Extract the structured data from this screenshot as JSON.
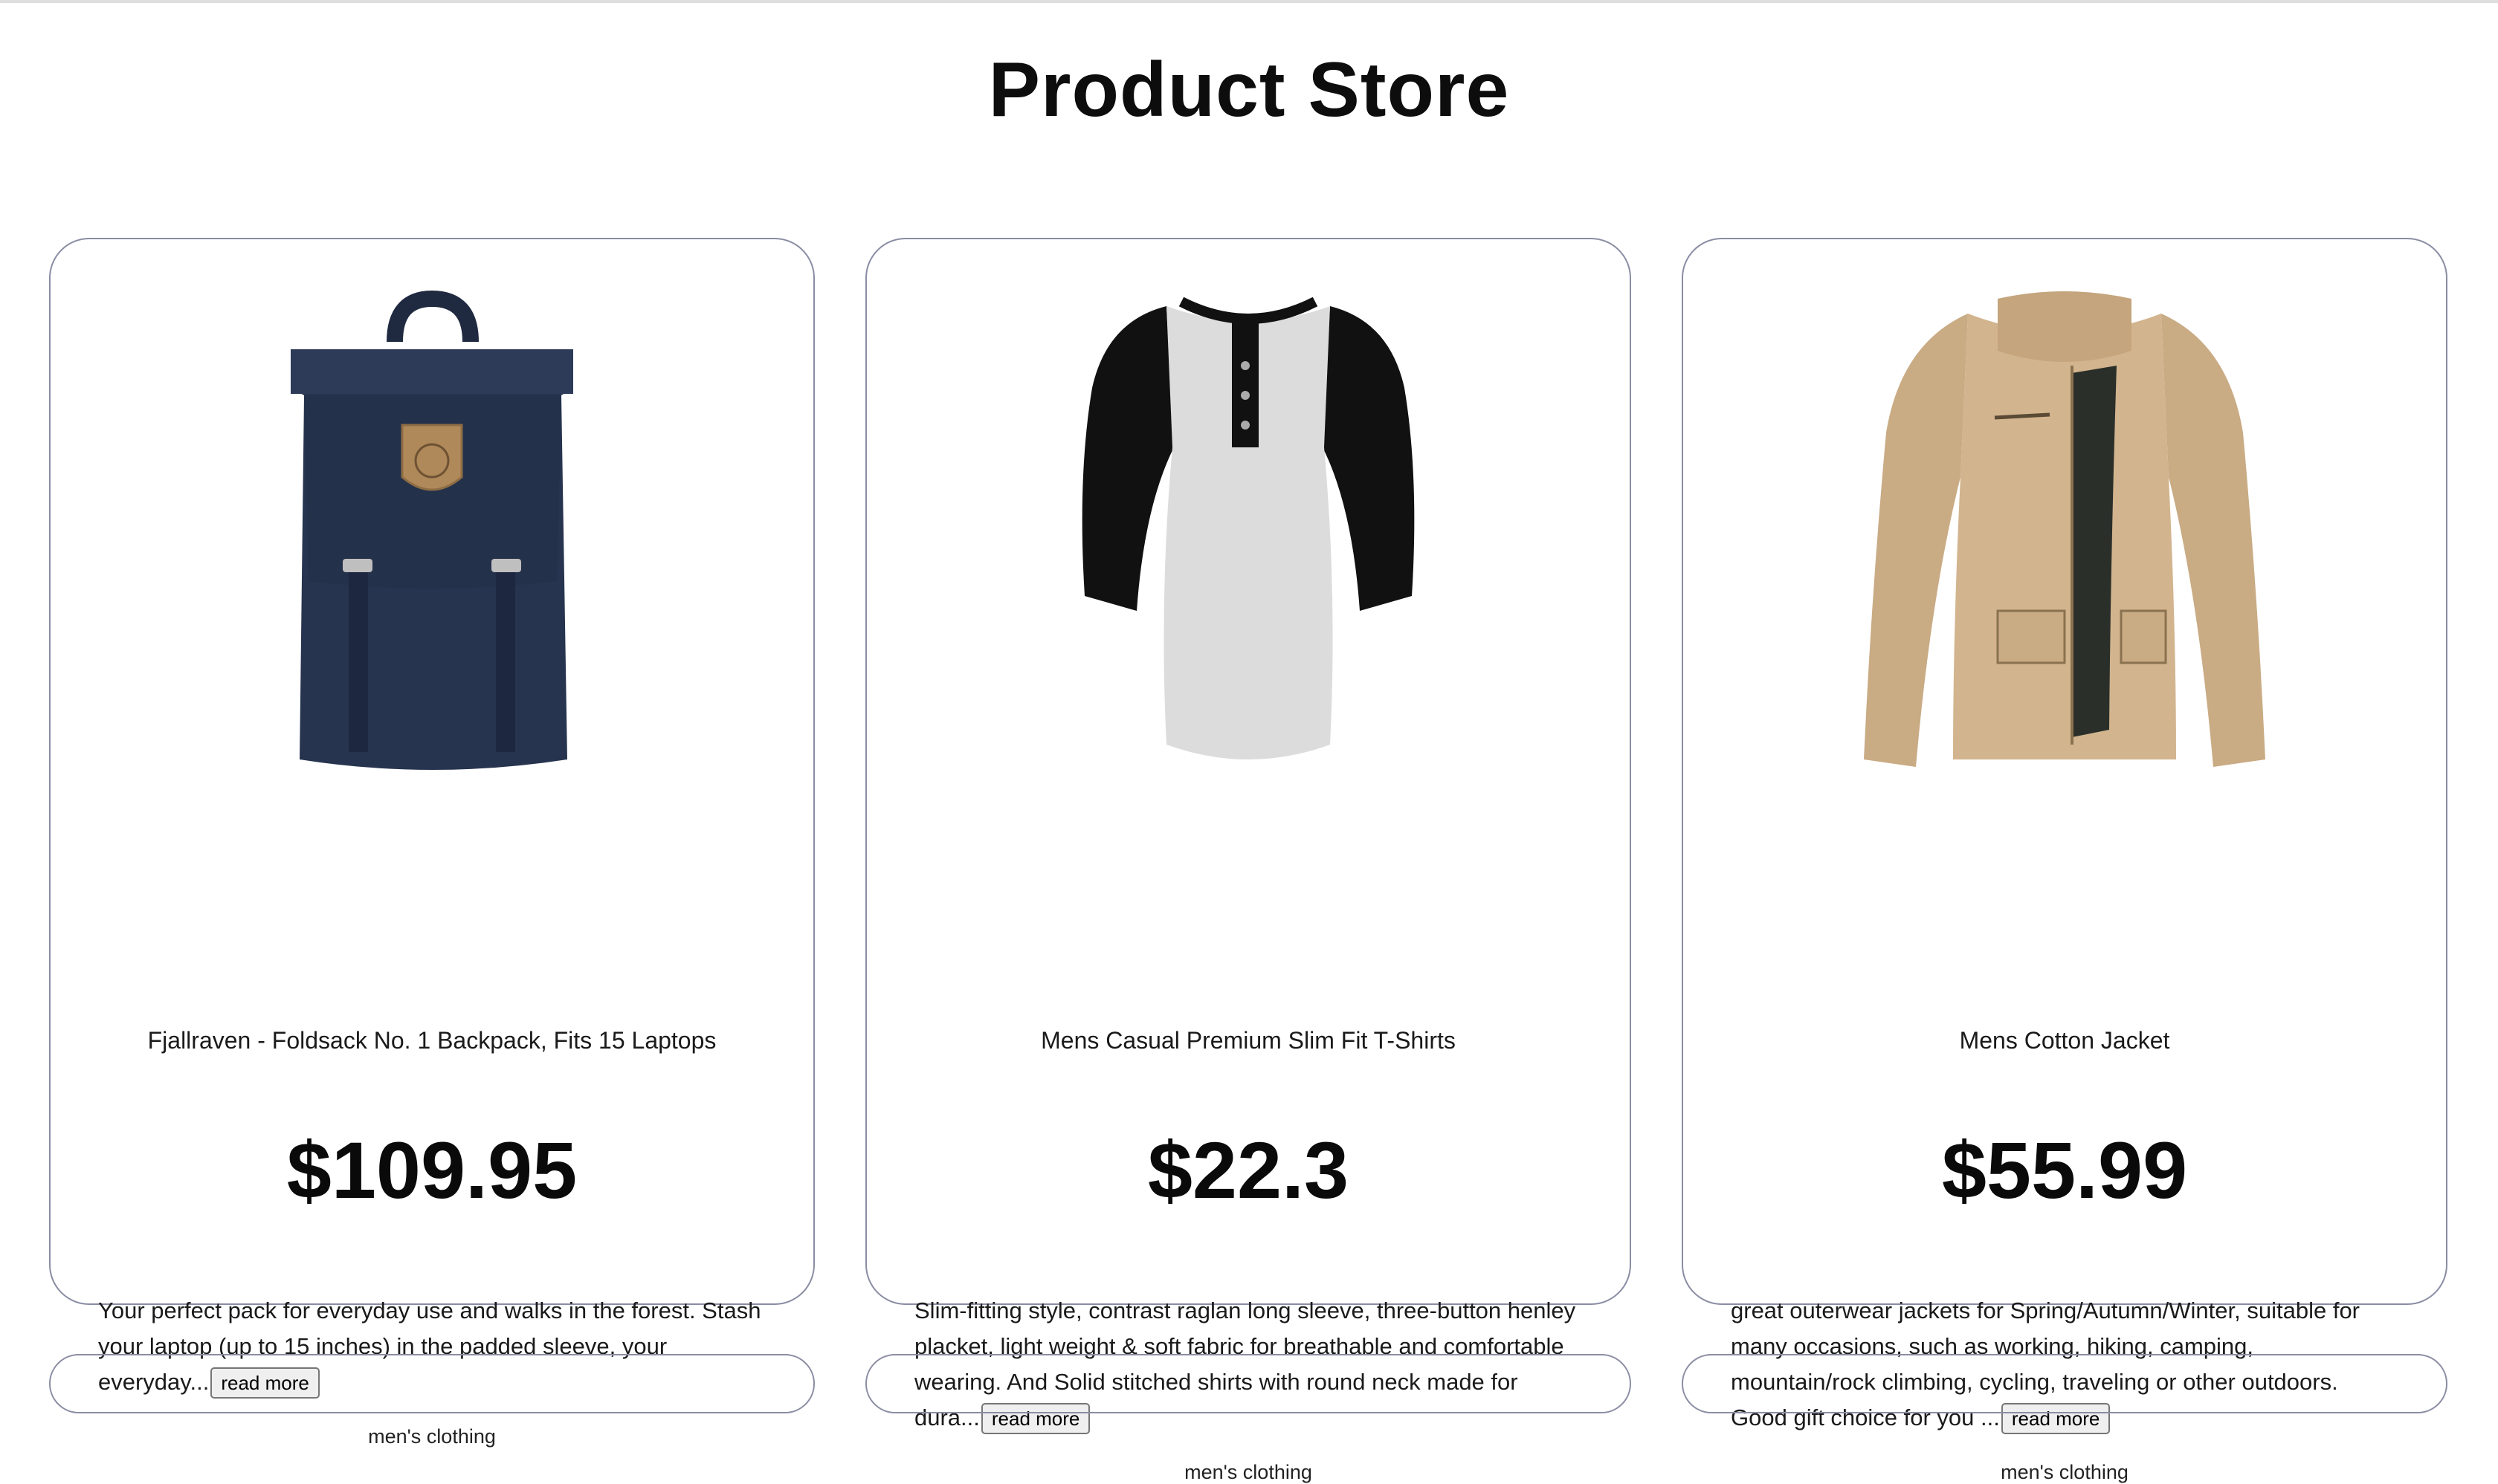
{
  "page": {
    "title": "Product Store"
  },
  "products": [
    {
      "name": "Fjallraven - Foldsack No. 1 Backpack, Fits 15 Laptops",
      "price": "$109.95",
      "description": "Your perfect pack for everyday use and walks in the forest. Stash your laptop (up to 15 inches) in the padded sleeve, your everyday...",
      "read_more": "read more",
      "category": "men's clothing",
      "image_icon": "backpack-image"
    },
    {
      "name": "Mens Casual Premium Slim Fit T-Shirts",
      "price": "$22.3",
      "description": "Slim-fitting style, contrast raglan long sleeve, three-button henley placket, light weight & soft fabric for breathable and comfortable wearing. And Solid stitched shirts with round neck made for dura...",
      "read_more": "read more",
      "category": "men's clothing",
      "image_icon": "tshirt-image"
    },
    {
      "name": "Mens Cotton Jacket",
      "price": "$55.99",
      "description": "great outerwear jackets for Spring/Autumn/Winter, suitable for many occasions, such as working, hiking, camping, mountain/rock climbing, cycling, traveling or other outdoors. Good gift choice for you ...",
      "read_more": "read more",
      "category": "men's clothing",
      "image_icon": "jacket-image"
    }
  ],
  "colors": {
    "card_border": "#8a8da3",
    "backpack": "#27344f",
    "tshirt_body": "#dcdcdc",
    "tshirt_sleeve": "#111111",
    "jacket": "#d2b48e"
  }
}
